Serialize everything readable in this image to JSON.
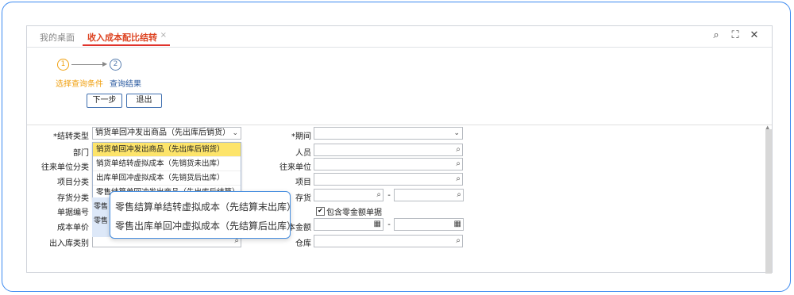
{
  "tabs": {
    "home": "我的桌面",
    "active": "收入成本配比结转",
    "close": "×"
  },
  "window_icons": {
    "search": "⌕",
    "fullscreen": "⛶",
    "close": "✕"
  },
  "steps": {
    "step1_num": "1",
    "step1_label": "选择查询条件",
    "step2_num": "2",
    "step2_label": "查询结果"
  },
  "buttons": {
    "next": "下一步",
    "exit": "退出"
  },
  "form": {
    "transfer_type_label": "*结转类型",
    "transfer_type_value": "销货单回冲发出商品（先出库后销货）",
    "department_label": "部门",
    "partner_category_label": "往来单位分类",
    "project_category_label": "项目分类",
    "stock_category_label": "存货分类",
    "doc_no_label": "单据编号",
    "cost_price_label": "成本单价",
    "io_type_label": "出入库类别",
    "period_label": "*期间",
    "person_label": "人员",
    "partner_label": "往来单位",
    "project_label": "项目",
    "stock_label": "存货",
    "include_zero_label": "包含零金额单据",
    "cost_amount_label": "本金额",
    "warehouse_label": "仓库",
    "dash": "-"
  },
  "dropdown_options": [
    "销货单回冲发出商品（先出库后销货）",
    "销货单结转虚拟成本（先销货未出库）",
    "出库单回冲虚拟成本（先销货后出库）",
    "零售结算单回冲发出商品（先出库后结算）"
  ],
  "partial_blue": {
    "line1": "零售",
    "line2": "零售"
  },
  "tooltip": {
    "line1": "零售结算单结转虚拟成本（先结算末出库）",
    "line2": "零售出库单回冲虚拟成本（先结算后出库）"
  },
  "colors": {
    "accent": "#3c8af0",
    "active_tab": "#e0332c",
    "step_active": "#f0a010",
    "dropdown_selected": "#fde46a"
  }
}
